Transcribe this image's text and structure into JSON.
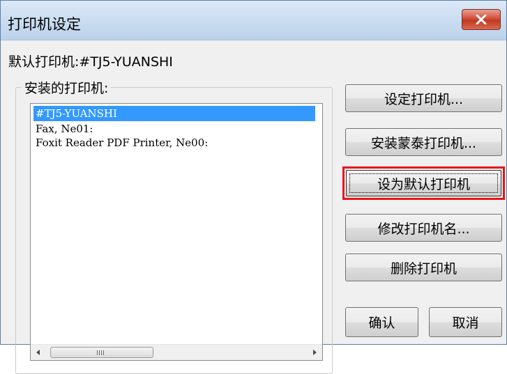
{
  "window": {
    "title": "打印机设定",
    "close_icon": "close-icon"
  },
  "default_printer": {
    "label": "默认打印机:#TJ5-YUANSHI"
  },
  "installed": {
    "group_label": "安装的打印机:",
    "items": [
      {
        "label": "#TJ5-YUANSHI",
        "selected": true
      },
      {
        "label": "Fax, Ne01:",
        "selected": false
      },
      {
        "label": "Foxit Reader PDF Printer, Ne00:",
        "selected": false
      }
    ]
  },
  "buttons": {
    "setup": "设定打印机...",
    "install": "安装蒙泰打印机...",
    "set_default": "设为默认打印机",
    "rename": "修改打印机名...",
    "delete": "删除打印机",
    "ok": "确认",
    "cancel": "取消"
  },
  "colors": {
    "highlight": "#e8141c",
    "selection": "#3399ff",
    "close_button": "#c23820"
  }
}
